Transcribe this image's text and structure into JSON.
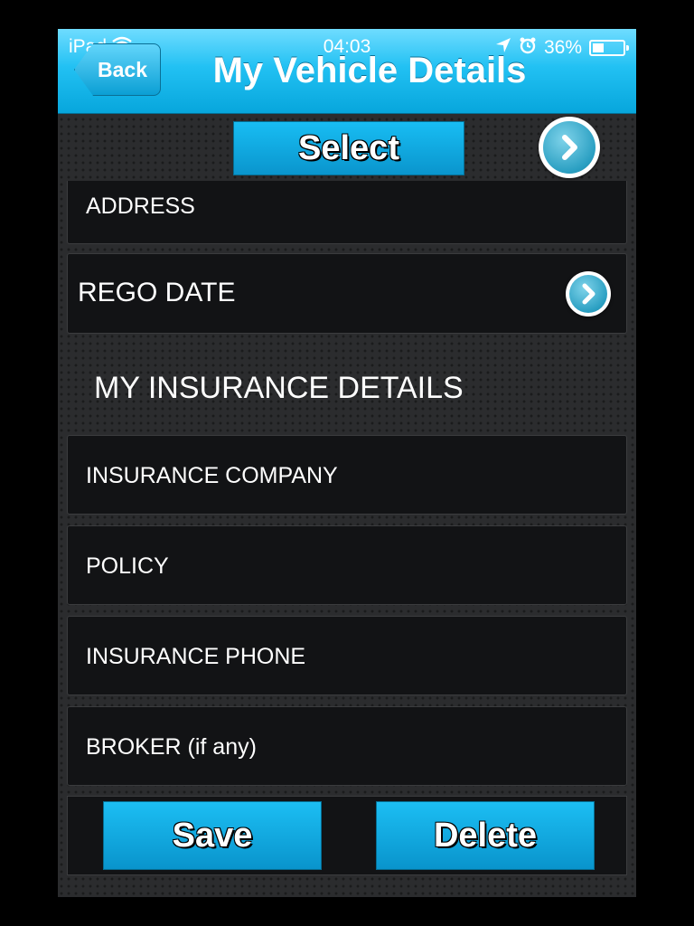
{
  "status_bar": {
    "carrier": "iPad",
    "time": "04:03",
    "battery": "36%",
    "battery_level": 0.36
  },
  "nav": {
    "back_label": "Back",
    "title": "My Vehicle Details"
  },
  "select_button": "Select",
  "fields_top": [
    {
      "label": "ADDRESS"
    },
    {
      "label": "REGO DATE"
    }
  ],
  "insurance_section_title": "MY INSURANCE DETAILS",
  "insurance_fields": [
    {
      "label": "INSURANCE COMPANY"
    },
    {
      "label": "POLICY"
    },
    {
      "label": "INSURANCE PHONE"
    },
    {
      "label": "BROKER (if any)"
    }
  ],
  "actions": {
    "save_label": "Save",
    "delete_label": "Delete"
  },
  "colors": {
    "accent": "#0aa6dd",
    "background": "#2b2c2e",
    "field_background": "#121315"
  },
  "icons": [
    "wifi-icon",
    "location-arrow-icon",
    "alarm-icon",
    "battery-icon",
    "chevron-right-icon"
  ]
}
